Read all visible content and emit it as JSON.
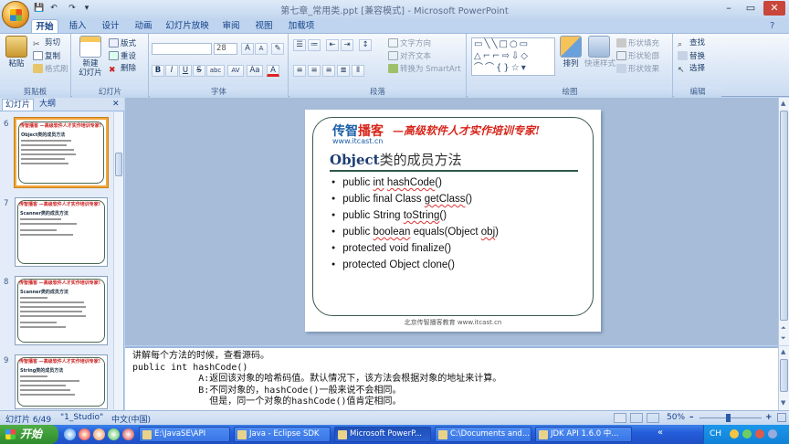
{
  "window": {
    "title": "第七章_常用类.ppt [兼容模式] - Microsoft PowerPoint",
    "min": "–",
    "max": "▭",
    "close": "✕"
  },
  "qat": {
    "save": "💾",
    "undo": "↶",
    "redo": "↷",
    "more": "▾"
  },
  "tabs": [
    "开始",
    "插入",
    "设计",
    "动画",
    "幻灯片放映",
    "审阅",
    "视图",
    "加载项"
  ],
  "ribbon": {
    "clipboard": {
      "label": "剪贴板",
      "paste": "粘贴",
      "cut": "剪切",
      "copy": "复制",
      "format_painter": "格式刷"
    },
    "slides": {
      "label": "幻灯片",
      "new_slide": "新建",
      "new_slide2": "幻灯片",
      "layout": "版式",
      "reset": "重设",
      "delete": "删除"
    },
    "font": {
      "label": "字体",
      "font_name": "",
      "font_size": "28",
      "grow": "A",
      "shrink": "A",
      "clear": "✎",
      "bold": "B",
      "italic": "I",
      "underline": "U",
      "strike": "S",
      "shadow": "abc",
      "spacing": "AV",
      "case": "Aa",
      "color": "A"
    },
    "paragraph": {
      "label": "段落",
      "text_direction": "文字方向",
      "align_text": "对齐文本",
      "smartart": "转换为 SmartArt"
    },
    "drawing": {
      "label": "绘图",
      "arrange": "排列",
      "quick_styles": "快速样式",
      "shape_fill": "形状填充",
      "shape_outline": "形状轮廓",
      "shape_effects": "形状效果"
    },
    "editing": {
      "label": "编辑",
      "find": "查找",
      "replace": "替换",
      "select": "选择"
    }
  },
  "pane": {
    "tab_slides": "幻灯片",
    "tab_outline": "大纲",
    "close": "✕"
  },
  "thumbnails": [
    {
      "num": "6",
      "title": "Object类的成员方法"
    },
    {
      "num": "7",
      "title": "Scanner类的成员方法"
    },
    {
      "num": "8",
      "title": "Scanner类的成员方法"
    },
    {
      "num": "9",
      "title": "String类的成员方法"
    }
  ],
  "slide": {
    "brand_a": "传智",
    "brand_b": "播客",
    "slogan": "—高级软件人才实作培训专家!",
    "site": "www.itcast.cn",
    "title_en": "Object",
    "title_cn": "类的成员方法",
    "bullets": [
      {
        "pre": "public ",
        "sq": "int",
        "mid": " ",
        "sq2": "hashCode",
        "post": "()"
      },
      {
        "pre": "public final Class ",
        "sq": "getClass",
        "mid": "",
        "sq2": "",
        "post": "()"
      },
      {
        "pre": "public String ",
        "sq": "toString",
        "mid": "",
        "sq2": "",
        "post": "()"
      },
      {
        "pre": "public ",
        "sq": "boolean",
        "mid": " equals(Object ",
        "sq2": "obj",
        "post": ")"
      },
      {
        "pre": "protected void finalize()",
        "sq": "",
        "mid": "",
        "sq2": "",
        "post": ""
      },
      {
        "pre": "protected Object clone()",
        "sq": "",
        "mid": "",
        "sq2": "",
        "post": ""
      }
    ],
    "footer": "北京传智播客教育 www.itcast.cn"
  },
  "notes": [
    "讲解每个方法的时候，查看源码。",
    "public int hashCode()",
    "            A:返回该对象的哈希码值。默认情况下，该方法会根据对象的地址来计算。",
    "            B:不同对象的，hashCode()一般来说不会相同。",
    "              但是，同一个对象的hashCode()值肯定相同。"
  ],
  "status": {
    "slide": "幻灯片 6/49",
    "theme": "\"1_Studio\"",
    "lang": "中文(中国)",
    "zoom": "50%",
    "minus": "–",
    "plus": "+"
  },
  "taskbar": {
    "start": "开始",
    "items": [
      "E:\\JavaSE\\API",
      "Java - Eclipse SDK",
      "Microsoft PowerP...",
      "C:\\Documents and...",
      "JDK API 1.6.0 中..."
    ],
    "tray": "CH"
  }
}
